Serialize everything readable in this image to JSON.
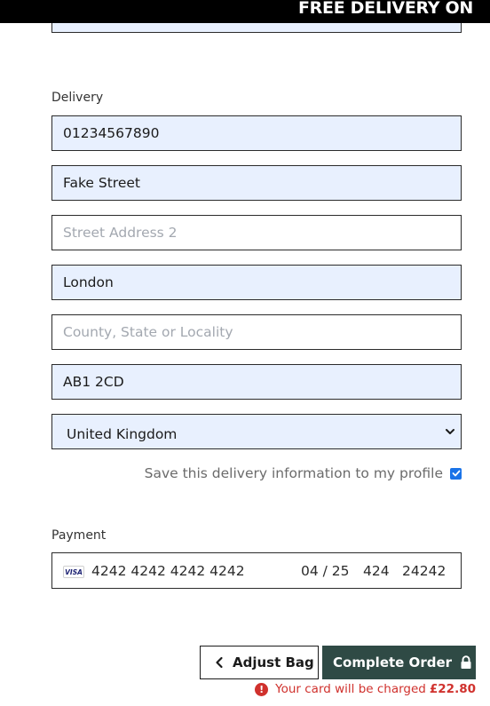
{
  "banner": {
    "text": "FREE DELIVERY ON"
  },
  "delivery": {
    "section_label": "Delivery",
    "phone": {
      "value": "01234567890"
    },
    "street_address": {
      "value": "Fake Street"
    },
    "street_address_2": {
      "placeholder": "Street Address 2"
    },
    "city": {
      "value": "London"
    },
    "county": {
      "placeholder": "County, State or Locality"
    },
    "postcode": {
      "value": "AB1 2CD"
    },
    "country": {
      "value": "United Kingdom"
    },
    "save_to_profile": {
      "label": "Save this delivery information to my profile",
      "checked": true
    }
  },
  "payment": {
    "section_label": "Payment",
    "card": {
      "brand": "VISA",
      "number": "4242 4242 4242 4242",
      "expiry": "04 / 25",
      "cvc": "424",
      "postal": "24242"
    }
  },
  "actions": {
    "adjust_bag_label": "Adjust Bag",
    "complete_order_label": "Complete Order",
    "charge_notice": "Your card will be charged",
    "charge_amount": "£22.80"
  },
  "colors": {
    "autofill_bg": "#e8f0fe",
    "primary_button": "#2f4a45",
    "error_red": "#d0312d",
    "checkbox_blue": "#1a73e8"
  },
  "icons": {
    "adjust_bag": "chevron-left-icon",
    "complete_order": "lock-icon",
    "country_select": "chevron-down-icon",
    "charge_notice": "alert-circle-icon"
  }
}
